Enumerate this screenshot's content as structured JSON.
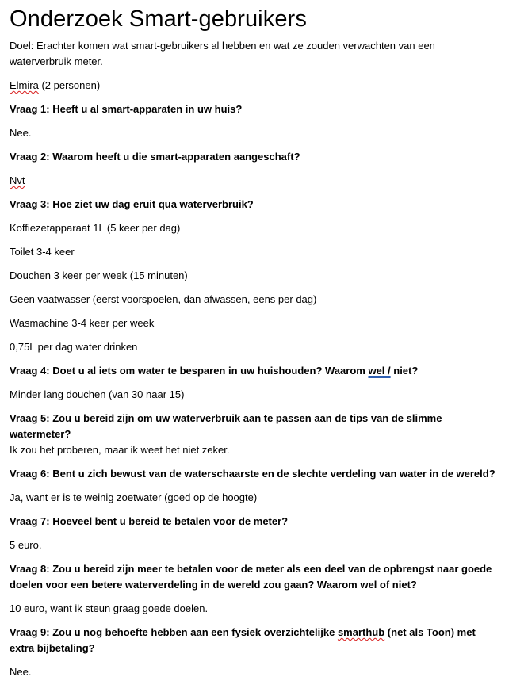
{
  "document": {
    "title": "Onderzoek Smart-gebruikers",
    "goal": "Doel: Erachter komen wat smart-gebruikers al hebben en wat ze zouden verwachten van een waterverbruik meter.",
    "respondent": {
      "name": "Elmira",
      "detail": " (2 personen)"
    },
    "q1": {
      "question": "Vraag 1: Heeft u al smart-apparaten in uw huis?",
      "answer": "Nee."
    },
    "q2": {
      "question": "Vraag 2: Waarom heeft u die smart-apparaten aangeschaft?",
      "answer": "Nvt"
    },
    "q3": {
      "question": "Vraag 3: Hoe ziet uw dag eruit qua waterverbruik?",
      "answers": [
        "Koffiezetapparaat 1L (5 keer per dag)",
        "Toilet 3-4 keer",
        "Douchen 3 keer per week (15 minuten)",
        "Geen vaatwasser (eerst voorspoelen, dan afwassen, eens per dag)",
        "Wasmachine 3-4 keer per week",
        "0,75L per dag water drinken"
      ]
    },
    "q4": {
      "question_part1": "Vraag 4: Doet u al iets om water te besparen in uw huishouden? Waarom ",
      "question_highlight": "wel /",
      "question_part2": " niet?",
      "answer": "Minder lang douchen (van 30 naar 15)"
    },
    "q5": {
      "question": "Vraag 5: Zou u bereid zijn om uw waterverbruik aan te passen aan de tips van de slimme watermeter?",
      "answer": "Ik zou het proberen, maar ik weet het niet zeker."
    },
    "q6": {
      "question": "Vraag 6: Bent u zich bewust van de waterschaarste en de slechte verdeling van water in de wereld?",
      "answer": "Ja, want er is te weinig zoetwater (goed op de hoogte)"
    },
    "q7": {
      "question": "Vraag 7: Hoeveel bent u bereid te betalen voor de meter?",
      "answer": "5 euro."
    },
    "q8": {
      "question": "Vraag 8: Zou u bereid zijn meer te betalen voor de meter als een deel van de opbrengst naar goede doelen voor een betere waterverdeling in de wereld zou gaan? Waarom wel of niet?",
      "answer": "10 euro, want ik steun graag goede doelen."
    },
    "q9": {
      "question_part1": "Vraag 9: Zou u nog behoefte hebben aan een fysiek overzichtelijke ",
      "question_highlight": "smarthub",
      "question_part2": " (net als Toon) met extra bijbetaling?",
      "answer": "Nee."
    }
  }
}
